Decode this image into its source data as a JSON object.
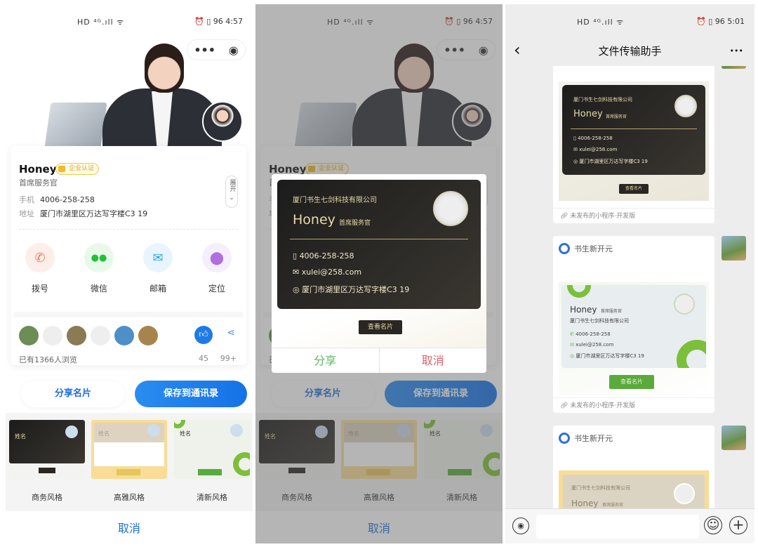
{
  "status_left": "HD ⁴ᴳ.ıll ᯤ",
  "status_right_1": "⏰ ▯ 96 4:57",
  "status_right_3": "⏰ ▯ 96 5:01",
  "capsule": {
    "more": "•••",
    "close": "◉"
  },
  "profile": {
    "name": "Honey",
    "badge": "企业认证",
    "title": "首席服务官",
    "phone_label": "手机",
    "phone": "4006-258-258",
    "address_label": "地址",
    "address": "厦门市湖里区万达写字楼C3 19",
    "expand": "展开",
    "actions": [
      {
        "label": "拨号",
        "icon": "phone-icon",
        "glyph": "✆",
        "color": "#f07b5a",
        "bg": "#fdeeea"
      },
      {
        "label": "微信",
        "icon": "wechat-icon",
        "glyph": "●●",
        "color": "#20c03a",
        "bg": "#e8f9ea"
      },
      {
        "label": "邮箱",
        "icon": "mail-icon",
        "glyph": "✉",
        "color": "#3aa0e6",
        "bg": "#e9f5fd"
      },
      {
        "label": "定位",
        "icon": "location-icon",
        "glyph": "⬤",
        "color": "#b06fe0",
        "bg": "#f5eefc"
      }
    ],
    "views": "已有1366人浏览",
    "likes": "45",
    "shares": "99+"
  },
  "buttons": {
    "share_card": "分享名片",
    "save_contact": "保存到通讯录",
    "cancel": "取消"
  },
  "templates": [
    {
      "label": "商务风格",
      "name": "姓名"
    },
    {
      "label": "高雅风格",
      "name": "姓名"
    },
    {
      "label": "清新风格",
      "name": "姓名"
    }
  ],
  "card": {
    "company": "厦门书生七剑科技有限公司",
    "name": "Honey",
    "title": "首席服务官",
    "phone": "4006-258-258",
    "email": "xulei@258.com",
    "address": "厦门市湖里区万达写字楼C3 19",
    "view_button": "查看名片"
  },
  "modal": {
    "share": "分享",
    "cancel": "取消",
    "share_color": "#5cb85c",
    "cancel_color": "#e0606a"
  },
  "chat": {
    "title": "文件传输助手",
    "back": "‹",
    "more": "•••",
    "sender": "书生新开元",
    "footer": "未发布的小程序·开发版",
    "emoji": "☺",
    "plus": "+",
    "voice": "◉"
  },
  "colors": {
    "primary": "#1e6fd9",
    "gold": "#e8d9a8",
    "green": "#5aaa3c"
  }
}
